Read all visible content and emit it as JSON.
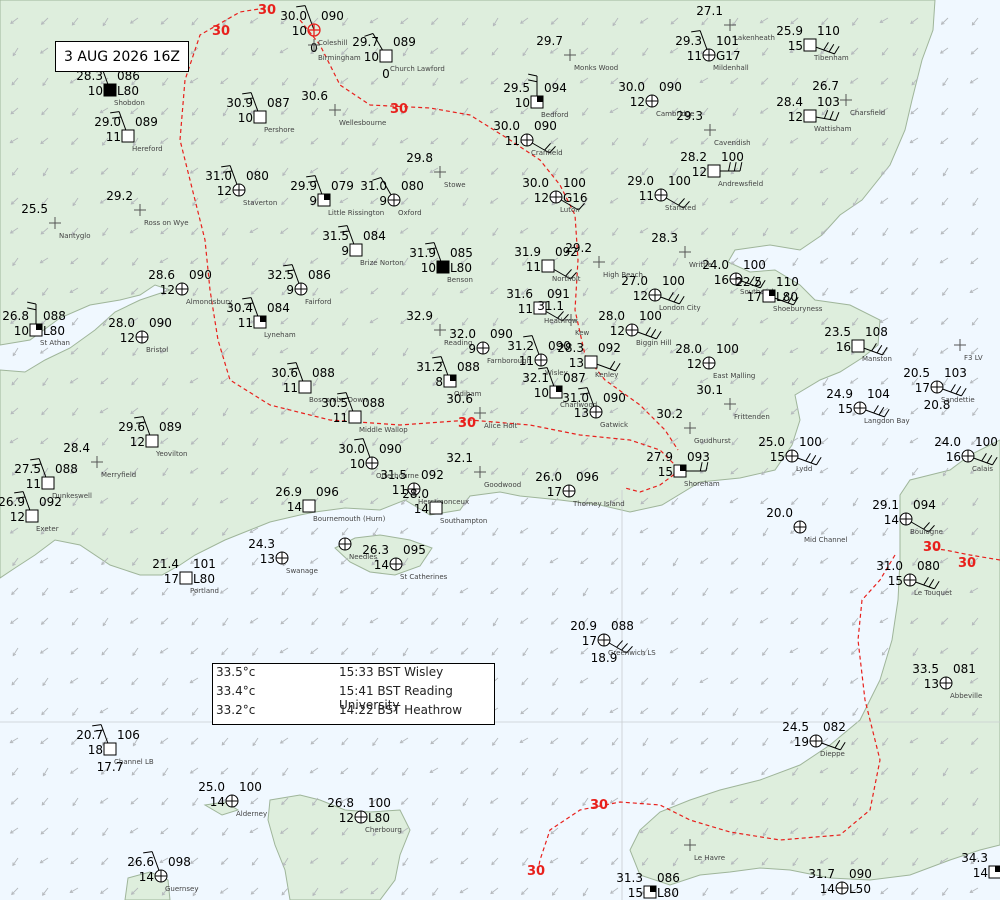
{
  "title": "3 AUG 2026 16Z",
  "info_rows": [
    {
      "value": "33.5°c",
      "text": "15:33 BST Wisley"
    },
    {
      "value": "33.4°c",
      "text": "15:41 BST Reading University"
    },
    {
      "value": "33.2°c",
      "text": "14:22 BST Heathrow"
    }
  ],
  "isotherm_labels": [
    "30",
    "30",
    "30",
    "30",
    "30",
    "30",
    "30"
  ],
  "colors": {
    "land": "#deeedd",
    "sea": "#f0f8ff",
    "coast": "#9fb59a",
    "isotherm": "#e8201c",
    "grid": "#c8ccd0",
    "station": "#000000",
    "place_text": "#444444"
  },
  "stations": [
    {
      "place": "Coleshill",
      "t": "30.0",
      "p": "090",
      "w": "10",
      "s": "0"
    },
    {
      "place": "Birmingham",
      "t": "",
      "p": "",
      "w": "",
      "s": ""
    },
    {
      "place": "Church Lawford",
      "t": "29.7",
      "p": "089",
      "w": "10",
      "s": "0"
    },
    {
      "place": "Monks Wood",
      "t": "29.7",
      "p": "",
      "w": "",
      "s": ""
    },
    {
      "place": "Shobdon",
      "t": "28.3",
      "p": "086",
      "w": "10",
      "s": "L80"
    },
    {
      "place": "Pershore",
      "t": "30.9",
      "p": "087",
      "w": "10",
      "s": ""
    },
    {
      "place": "Wellesbourne",
      "t": "30.6",
      "p": "",
      "w": "",
      "s": ""
    },
    {
      "place": "Bedford",
      "t": "29.5",
      "p": "094",
      "w": "10",
      "s": ""
    },
    {
      "place": "Cambridge",
      "t": "30.0",
      "p": "090",
      "w": "12",
      "s": ""
    },
    {
      "place": "Lakenheath",
      "t": "27.1",
      "p": "",
      "w": "",
      "s": ""
    },
    {
      "place": "Mildenhall",
      "t": "29.3",
      "p": "101",
      "w": "11",
      "s": "G17"
    },
    {
      "place": "Tibenham",
      "t": "25.9",
      "p": "110",
      "w": "15",
      "s": ""
    },
    {
      "place": "Hereford",
      "t": "29.0",
      "p": "089",
      "w": "11",
      "s": ""
    },
    {
      "place": "Cranfield",
      "t": "30.0",
      "p": "090",
      "w": "11",
      "s": ""
    },
    {
      "place": "Cavendish",
      "t": "29.3",
      "p": "",
      "w": "",
      "s": ""
    },
    {
      "place": "Wattisham",
      "t": "28.4",
      "p": "103",
      "w": "12",
      "s": ""
    },
    {
      "place": "Charsfield",
      "t": "26.7",
      "p": "",
      "w": "",
      "s": ""
    },
    {
      "place": "Staverton",
      "t": "31.0",
      "p": "080",
      "w": "12",
      "s": ""
    },
    {
      "place": "Little Rissington",
      "t": "29.9",
      "p": "079",
      "w": "9",
      "s": ""
    },
    {
      "place": "Oxford",
      "t": "31.0",
      "p": "080",
      "w": "9",
      "s": ""
    },
    {
      "place": "Stowe",
      "t": "29.8",
      "p": "",
      "w": "",
      "s": ""
    },
    {
      "place": "Luton",
      "t": "30.0",
      "p": "100",
      "w": "12",
      "s": "G16"
    },
    {
      "place": "Stansted",
      "t": "29.0",
      "p": "100",
      "w": "11",
      "s": ""
    },
    {
      "place": "Andrewsfield",
      "t": "28.2",
      "p": "100",
      "w": "12",
      "s": ""
    },
    {
      "place": "Ross on Wye",
      "t": "29.2",
      "p": "",
      "w": "",
      "s": ""
    },
    {
      "place": "Nantyglo",
      "t": "25.5",
      "p": "",
      "w": "",
      "s": ""
    },
    {
      "place": "Brize Norton",
      "t": "31.5",
      "p": "084",
      "w": "9",
      "s": ""
    },
    {
      "place": "Benson",
      "t": "31.9",
      "p": "085",
      "w": "10",
      "s": "L80"
    },
    {
      "place": "Northolt",
      "t": "31.9",
      "p": "092",
      "w": "11",
      "s": ""
    },
    {
      "place": "High Beach",
      "t": "29.2",
      "p": "",
      "w": "",
      "s": ""
    },
    {
      "place": "Writtle",
      "t": "28.3",
      "p": "",
      "w": "",
      "s": ""
    },
    {
      "place": "Southend",
      "t": "24.0",
      "p": "100",
      "w": "16",
      "s": ""
    },
    {
      "place": "Shoeburyness",
      "t": "22.5",
      "p": "110",
      "w": "17",
      "s": "L80"
    },
    {
      "place": "Almondsbury",
      "t": "28.6",
      "p": "090",
      "w": "12",
      "s": ""
    },
    {
      "place": "Fairford",
      "t": "32.5",
      "p": "086",
      "w": "9",
      "s": ""
    },
    {
      "place": "London City",
      "t": "27.0",
      "p": "100",
      "w": "12",
      "s": ""
    },
    {
      "place": "St Athan",
      "t": "26.8",
      "p": "088",
      "w": "10",
      "s": "L80"
    },
    {
      "place": "Bristol",
      "t": "28.0",
      "p": "090",
      "w": "12",
      "s": ""
    },
    {
      "place": "Lyneham",
      "t": "30.4",
      "p": "084",
      "w": "11",
      "s": ""
    },
    {
      "place": "Heathrow",
      "t": "31.6",
      "p": "091",
      "w": "11",
      "s": ""
    },
    {
      "place": "Kew",
      "t": "31.1",
      "p": "",
      "w": "",
      "s": ""
    },
    {
      "place": "Biggin Hill",
      "t": "28.0",
      "p": "100",
      "w": "12",
      "s": ""
    },
    {
      "place": "Manston",
      "t": "23.5",
      "p": "108",
      "w": "16",
      "s": ""
    },
    {
      "place": "Reading",
      "t": "32.9",
      "p": "",
      "w": "",
      "s": ""
    },
    {
      "place": "Farnborough",
      "t": "32.0",
      "p": "090",
      "w": "9",
      "s": ""
    },
    {
      "place": "Wisley",
      "t": "31.2",
      "p": "090",
      "w": "11",
      "s": ""
    },
    {
      "place": "Kenley",
      "t": "28.3",
      "p": "092",
      "w": "13",
      "s": ""
    },
    {
      "place": "East Malling",
      "t": "28.0",
      "p": "100",
      "w": "12",
      "s": ""
    },
    {
      "place": "Sandettie",
      "t": "20.5",
      "p": "103",
      "w": "17",
      "s": "20.8"
    },
    {
      "place": "Boscombe Down",
      "t": "30.6",
      "p": "088",
      "w": "11",
      "s": ""
    },
    {
      "place": "Odiham",
      "t": "31.2",
      "p": "088",
      "w": "8",
      "s": ""
    },
    {
      "place": "Charlwood",
      "t": "32.1",
      "p": "087",
      "w": "10",
      "s": ""
    },
    {
      "place": "Gatwick",
      "t": "31.0",
      "p": "090",
      "w": "13",
      "s": ""
    },
    {
      "place": "Langdon Bay",
      "t": "24.9",
      "p": "104",
      "w": "15",
      "s": ""
    },
    {
      "place": "Frittenden",
      "t": "30.1",
      "p": "",
      "w": "",
      "s": ""
    },
    {
      "place": "Middle Wallop",
      "t": "30.5",
      "p": "088",
      "w": "11",
      "s": ""
    },
    {
      "place": "Alice Holt",
      "t": "30.6",
      "p": "",
      "w": "",
      "s": ""
    },
    {
      "place": "Goudhurst",
      "t": "30.2",
      "p": "",
      "w": "",
      "s": ""
    },
    {
      "place": "Calais",
      "t": "24.0",
      "p": "100",
      "w": "16",
      "s": ""
    },
    {
      "place": "Yeovilton",
      "t": "29.6",
      "p": "089",
      "w": "12",
      "s": ""
    },
    {
      "place": "Otterbourne",
      "t": "30.0",
      "p": "090",
      "w": "10",
      "s": ""
    },
    {
      "place": "Lydd",
      "t": "25.0",
      "p": "100",
      "w": "15",
      "s": ""
    },
    {
      "place": "Merryfield",
      "t": "28.4",
      "p": "",
      "w": "",
      "s": ""
    },
    {
      "place": "Dunkeswell",
      "t": "27.5",
      "p": "088",
      "w": "11",
      "s": ""
    },
    {
      "place": "Goodwood",
      "t": "32.1",
      "p": "",
      "w": "",
      "s": ""
    },
    {
      "place": "Herstmonceux",
      "t": "31.5",
      "p": "092",
      "w": "11",
      "s": ""
    },
    {
      "place": "Southampton",
      "t": "28.0",
      "p": "",
      "w": "14",
      "s": ""
    },
    {
      "place": "Thorney Island",
      "t": "26.0",
      "p": "096",
      "w": "17",
      "s": ""
    },
    {
      "place": "Shoreham",
      "t": "27.9",
      "p": "093",
      "w": "15",
      "s": ""
    },
    {
      "place": "Boulogne",
      "t": "29.1",
      "p": "094",
      "w": "14",
      "s": ""
    },
    {
      "place": "Exeter",
      "t": "26.9",
      "p": "092",
      "w": "12",
      "s": ""
    },
    {
      "place": "Bournemouth (Hurn)",
      "t": "26.9",
      "p": "096",
      "w": "14",
      "s": ""
    },
    {
      "place": "Mid Channel",
      "t": "20.0",
      "p": "",
      "w": "",
      "s": ""
    },
    {
      "place": "Swanage",
      "t": "24.3",
      "p": "",
      "w": "13",
      "s": ""
    },
    {
      "place": "Needles",
      "t": "",
      "p": "",
      "w": "",
      "s": ""
    },
    {
      "place": "St Catherines",
      "t": "26.3",
      "p": "095",
      "w": "14",
      "s": ""
    },
    {
      "place": "Le Touquet",
      "t": "31.0",
      "p": "080",
      "w": "15",
      "s": ""
    },
    {
      "place": "Portland",
      "t": "21.4",
      "p": "101",
      "w": "17",
      "s": "L80"
    },
    {
      "place": "Greenwich LS",
      "t": "20.9",
      "p": "088",
      "w": "17",
      "s": "18.9"
    },
    {
      "place": "Abbeville",
      "t": "33.5",
      "p": "081",
      "w": "13",
      "s": ""
    },
    {
      "place": "Channel LB",
      "t": "20.7",
      "p": "106",
      "w": "18",
      "s": "17.7"
    },
    {
      "place": "Dieppe",
      "t": "24.5",
      "p": "082",
      "w": "19",
      "s": ""
    },
    {
      "place": "Alderney",
      "t": "25.0",
      "p": "100",
      "w": "14",
      "s": ""
    },
    {
      "place": "Cherbourg",
      "t": "26.8",
      "p": "100",
      "w": "12",
      "s": "L80"
    },
    {
      "place": "Le Havre",
      "t": "",
      "p": "",
      "w": "",
      "s": ""
    },
    {
      "place": "Guernsey",
      "t": "26.6",
      "p": "098",
      "w": "14",
      "s": ""
    },
    {
      "place": "",
      "t": "31.3",
      "p": "086",
      "w": "15",
      "s": "L80"
    },
    {
      "place": "",
      "t": "31.7",
      "p": "090",
      "w": "14",
      "s": "L50"
    },
    {
      "place": "",
      "t": "34.3",
      "p": "",
      "w": "14",
      "s": ""
    },
    {
      "place": "F3 LV",
      "t": "",
      "p": "",
      "w": "",
      "s": ""
    }
  ]
}
